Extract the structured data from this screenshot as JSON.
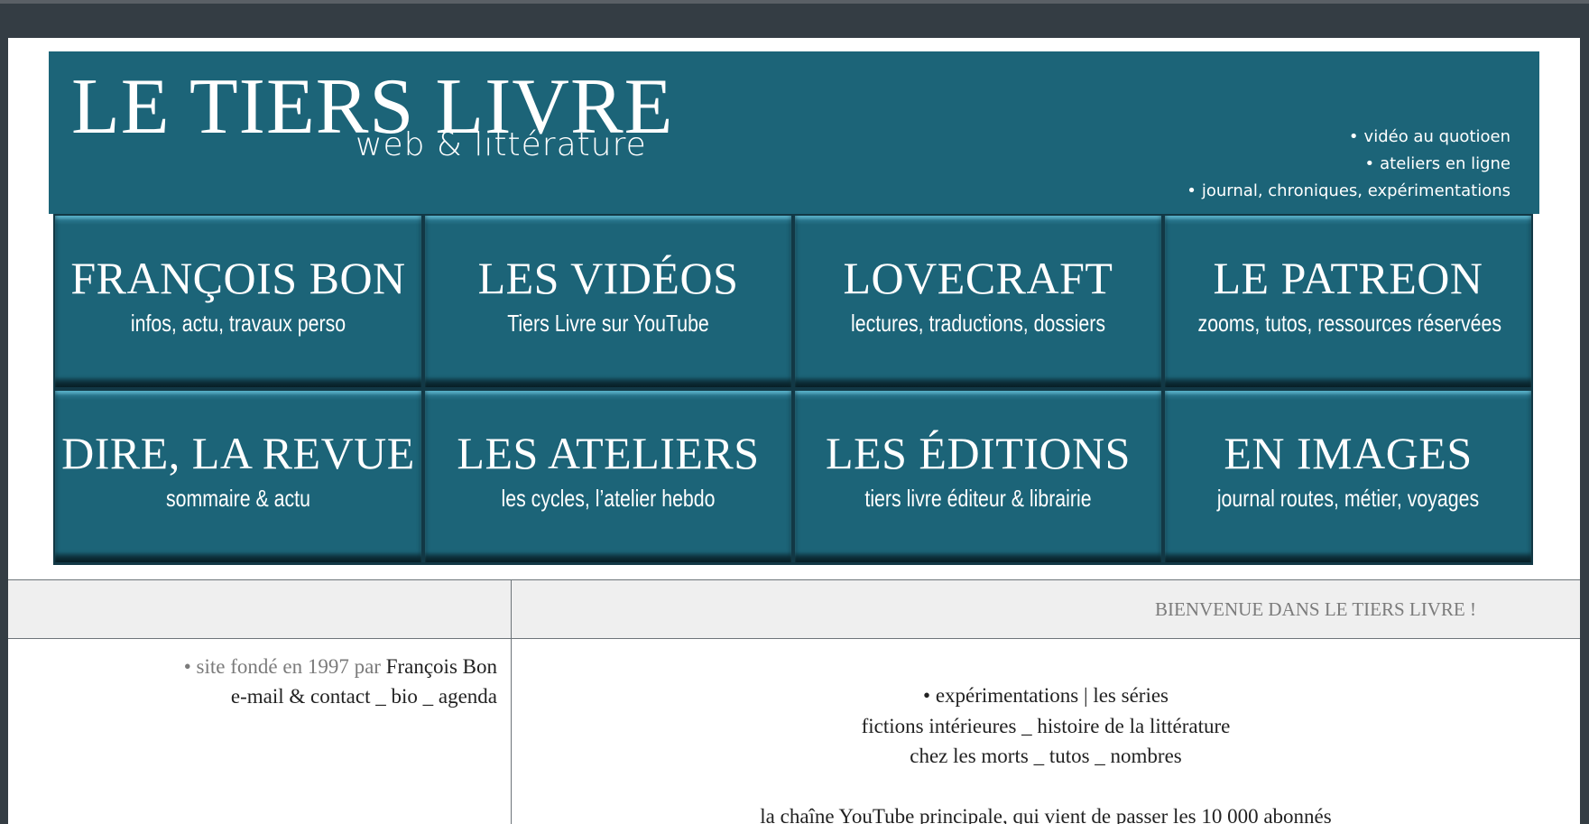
{
  "header": {
    "title": "LE TIERS LIVRE",
    "subtitle": "web & littérature",
    "links": [
      "vidéo au quotioen",
      "ateliers en ligne",
      "journal, chroniques, expérimentations"
    ]
  },
  "tiles": [
    {
      "title": "FRANÇOIS BON",
      "subtitle": "infos, actu, travaux perso"
    },
    {
      "title": "LES VIDÉOS",
      "subtitle": "Tiers Livre sur YouTube"
    },
    {
      "title": "LOVECRAFT",
      "subtitle": "lectures, traductions, dossiers"
    },
    {
      "title": "LE PATREON",
      "subtitle": "zooms, tutos, ressources réservées"
    },
    {
      "title": "DIRE, LA REVUE",
      "subtitle": "sommaire & actu"
    },
    {
      "title": "LES ATELIERS",
      "subtitle": "les cycles, l’atelier hebdo"
    },
    {
      "title": "LES ÉDITIONS",
      "subtitle": "tiers livre éditeur & librairie"
    },
    {
      "title": "EN IMAGES",
      "subtitle": "journal routes, métier, voyages"
    }
  ],
  "welcome": "BIENVENUE DANS LE TIERS LIVRE !",
  "left": {
    "founded_prefix": "• site fondé en 1997 par",
    "author": "François Bon",
    "links": [
      "e-mail & contact",
      "bio",
      "agenda"
    ],
    "separator": "_"
  },
  "right": {
    "line1_prefix": "•",
    "line1_links": [
      "expérimentations",
      "les séries"
    ],
    "line1_sep": "|",
    "line2_links": [
      "fictions intérieures",
      "histoire de la littérature"
    ],
    "line3_links": [
      "chez les morts",
      "tutos",
      "nombres"
    ],
    "separator": "_",
    "youtube_line": "la chaîne YouTube principale, qui vient de passer les 10 000 abonnés"
  },
  "colors": {
    "banner": "#1c6478",
    "frame": "#343d44",
    "header_row": "#efefef"
  }
}
